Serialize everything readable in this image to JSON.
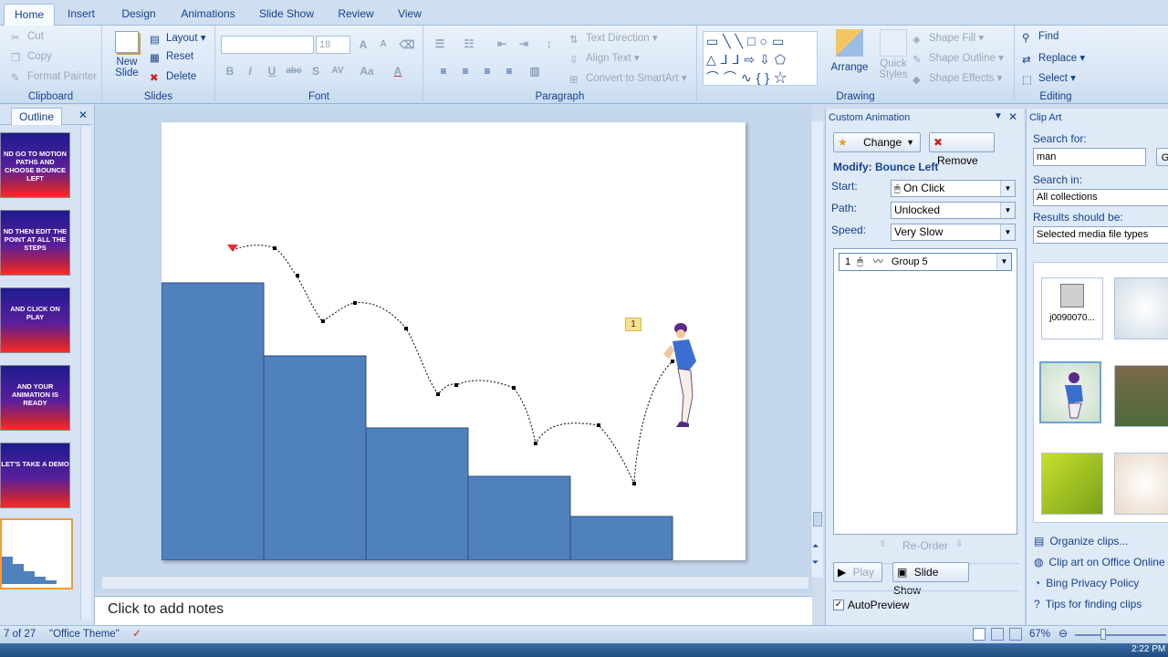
{
  "tabs": [
    "Home",
    "Insert",
    "Design",
    "Animations",
    "Slide Show",
    "Review",
    "View"
  ],
  "ribbon": {
    "clipboard": {
      "cut": "Cut",
      "copy": "Copy",
      "format_painter": "Format Painter",
      "label": "Clipboard"
    },
    "slides": {
      "new_slide": "New",
      "new_slide2": "Slide",
      "layout": "Layout",
      "reset": "Reset",
      "delete": "Delete",
      "label": "Slides"
    },
    "font": {
      "size": "18",
      "bold": "B",
      "italic": "I",
      "underline": "U",
      "strike": "abc",
      "shadow": "S",
      "label": "Font"
    },
    "paragraph": {
      "text_direction": "Text Direction",
      "align_text": "Align Text",
      "convert_smartart": "Convert to SmartArt",
      "label": "Paragraph"
    },
    "drawing": {
      "arrange": "Arrange",
      "quick_styles": "Quick",
      "quick_styles2": "Styles",
      "shape_fill": "Shape Fill",
      "shape_outline": "Shape Outline",
      "shape_effects": "Shape Effects",
      "label": "Drawing"
    },
    "editing": {
      "find": "Find",
      "replace": "Replace",
      "select": "Select",
      "label": "Editing"
    }
  },
  "outline": {
    "tab_label": "Outline",
    "thumbs": [
      "ND GO TO MOTION PATHS AND CHOOSE BOUNCE LEFT",
      "ND THEN EDIT THE POINT AT ALL THE STEPS",
      "AND CLICK ON PLAY",
      "AND YOUR ANIMATION IS READY",
      "LET'S TAKE A DEMO"
    ]
  },
  "slide": {
    "anim_tag": "1"
  },
  "notes": {
    "placeholder": "Click to add notes"
  },
  "custom_animation": {
    "title": "Custom Animation",
    "change": "Change",
    "remove": "Remove",
    "modify": "Modify: Bounce Left",
    "start_label": "Start:",
    "start_value": "On Click",
    "path_label": "Path:",
    "path_value": "Unlocked",
    "speed_label": "Speed:",
    "speed_value": "Very Slow",
    "list_item_num": "1",
    "list_item_name": "Group 5",
    "reorder": "Re-Order",
    "play": "Play",
    "slide_show": "Slide Show",
    "autopreview": "AutoPreview"
  },
  "clip_art": {
    "title": "Clip Art",
    "search_for": "Search for:",
    "search_value": "man",
    "go_label": "G",
    "search_in": "Search in:",
    "search_in_value": "All collections",
    "results_label": "Results should be:",
    "results_value": "Selected media file types",
    "clip1_name": "j0090070...",
    "links": [
      "Organize clips...",
      "Clip art on Office Online",
      "Bing Privacy Policy",
      "Tips for finding clips"
    ]
  },
  "status": {
    "slide_of": "7 of 27",
    "theme": "\"Office Theme\"",
    "zoom": "67%"
  },
  "taskbar": {
    "clock": "2:22 PM"
  },
  "colors": {
    "step_fill": "#4f81bd",
    "step_stroke": "#2c4d75",
    "ribbon_text": "#15428b"
  }
}
